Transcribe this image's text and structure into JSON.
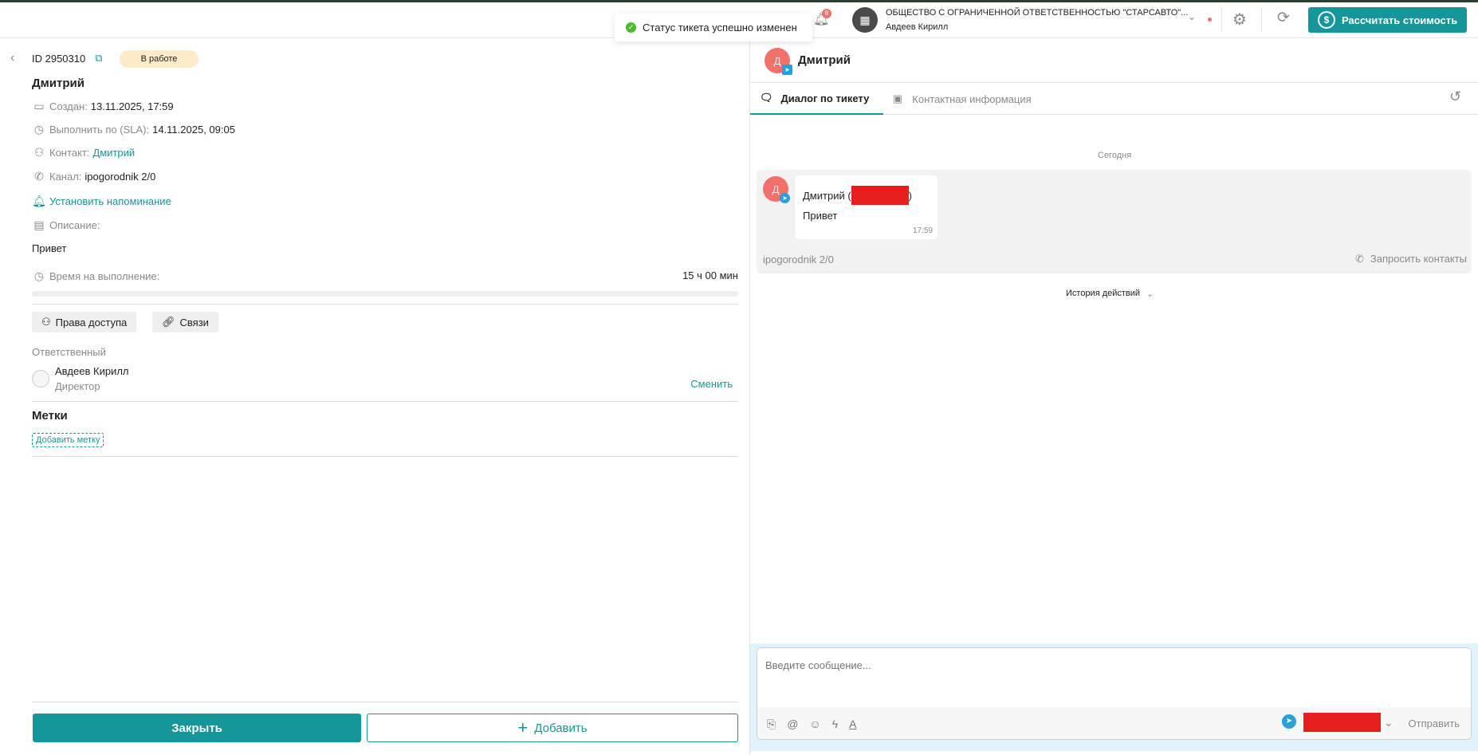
{
  "toast": {
    "text": "Статус тикета успешно изменен"
  },
  "header": {
    "notifications_count": "8",
    "org_name": "ОБЩЕСТВО С ОГРАНИЧЕННОЙ ОТВЕТСТВЕННОСТЬЮ \"СТАРСАВТО\"...",
    "user_name": "Авдеев Кирилл",
    "calc_button": "Рассчитать стоимость"
  },
  "ticket": {
    "id": "ID 2950310",
    "status": "В работе",
    "name": "Дмитрий",
    "created_label": "Создан:",
    "created_value": "13.11.2025, 17:59",
    "sla_label": "Выполнить по (SLA):",
    "sla_value": "14.11.2025, 09:05",
    "contact_label": "Контакт:",
    "contact_value": "Дмитрий",
    "channel_label": "Канал:",
    "channel_value": "ipogorodnik 2/0",
    "reminder": "Установить напоминание",
    "description_label": "Описание:",
    "description_value": "Привет",
    "time_label": "Время на выполнение:",
    "time_value": "15 ч 00 мин",
    "time_progress": 0,
    "access_button": "Права доступа",
    "links_button": "Связи",
    "responsible_label": "Ответственный",
    "responsible_name": "Авдеев Кирилл",
    "responsible_role": "Директор",
    "change_link": "Сменить",
    "tags_title": "Метки",
    "add_tag": "Добавить метку",
    "close_button": "Закрыть",
    "add_button": "Добавить"
  },
  "chat": {
    "contact_name": "Дмитрий",
    "avatar_letter": "Д",
    "tabs": [
      {
        "label": "Диалог по тикету",
        "active": true
      },
      {
        "label": "Контактная информация",
        "active": false
      }
    ],
    "date_divider": "Сегодня",
    "message": {
      "author": "Дмитрий (",
      "author_end": ")",
      "text": "Привет",
      "time": "17:59",
      "channel": "ipogorodnik 2/0",
      "request_contacts": "Запросить контакты"
    },
    "history": "История действий",
    "composer_placeholder": "Введите сообщение...",
    "send": "Отправить"
  },
  "colors": {
    "accent": "#16969a",
    "avatar": "#f0706a",
    "telegram": "#2a9fd8",
    "status_bg": "#fdebc8"
  }
}
